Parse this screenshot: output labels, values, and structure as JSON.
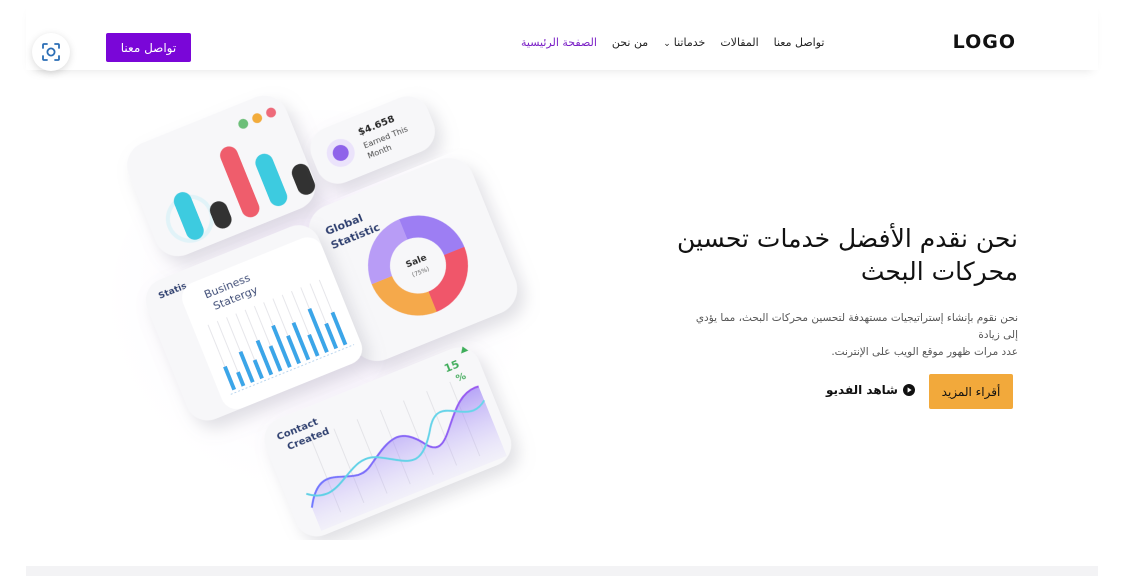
{
  "header": {
    "logo": "LOGO",
    "nav": {
      "home": "الصفحة الرئيسية",
      "about": "من نحن",
      "services": "خدماتنا",
      "articles": "المقالات",
      "contact": "تواصل معنا"
    },
    "cta_label": "تواصل معنا",
    "scan_icon": "scan-focus-icon"
  },
  "hero": {
    "title_line1": "نحن نقدم الأفضل خدمات تحسين",
    "title_line2": "محركات البحث",
    "subtitle_line1": "نحن نقوم بإنشاء إستراتيجيات مستهدفة لتحسين محركات البحث، مما يؤدي إلى زيادة",
    "subtitle_line2": "عدد مرات ظهور موقع الويب على الإنترنت.",
    "read_more_label": "أقراء المزيد",
    "watch_video_label": "شاهد الفديو"
  },
  "illustration": {
    "earned_value": "$4.658",
    "earned_line1": "Earned This",
    "earned_line2": "Month",
    "global_stat_line1": "Global",
    "global_stat_line2": "Statistic",
    "sale_label": "Sale",
    "sale_percent": "(75%)",
    "statis_label": "Statis",
    "business_line1": "Business",
    "business_line2": "Statergy",
    "contact_line1": "Contact",
    "contact_line2": "Created",
    "contact_percent_value": "15",
    "contact_percent_sign": "%"
  },
  "colors": {
    "brand_purple": "#7a06d8",
    "accent_orange": "#f2a93b",
    "active_nav": "#7a1fc6"
  }
}
